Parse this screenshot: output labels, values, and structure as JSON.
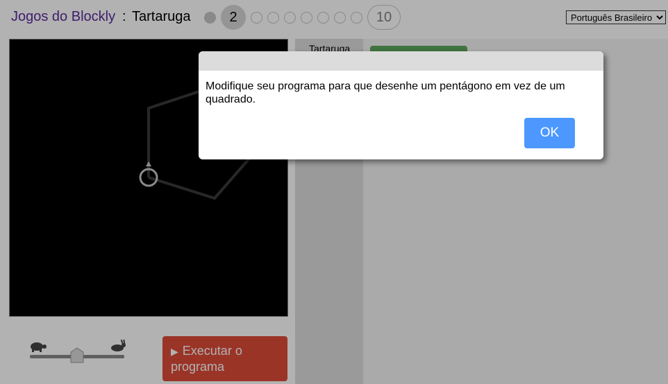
{
  "header": {
    "app_title": "Jogos do Blockly",
    "separator": ":",
    "level_name": "Tartaruga",
    "levels": {
      "current": "2",
      "last": "10"
    },
    "language": "Português Brasileiro"
  },
  "toolbox": {
    "category": "Tartaruga"
  },
  "controls": {
    "run_label": "Executar o programa",
    "run_icon": "play-icon",
    "slow_icon": "turtle-icon",
    "fast_icon": "rabbit-icon",
    "speed_level": 0.5
  },
  "dialog": {
    "message": "Modifique seu programa para que desenhe um pentágono em vez de um quadrado.",
    "ok_label": "OK"
  },
  "colors": {
    "app_link": "#5a2a9a",
    "run_button": "#dd4b39",
    "ok_button": "#4c98ff",
    "block": "#5ba55b"
  }
}
